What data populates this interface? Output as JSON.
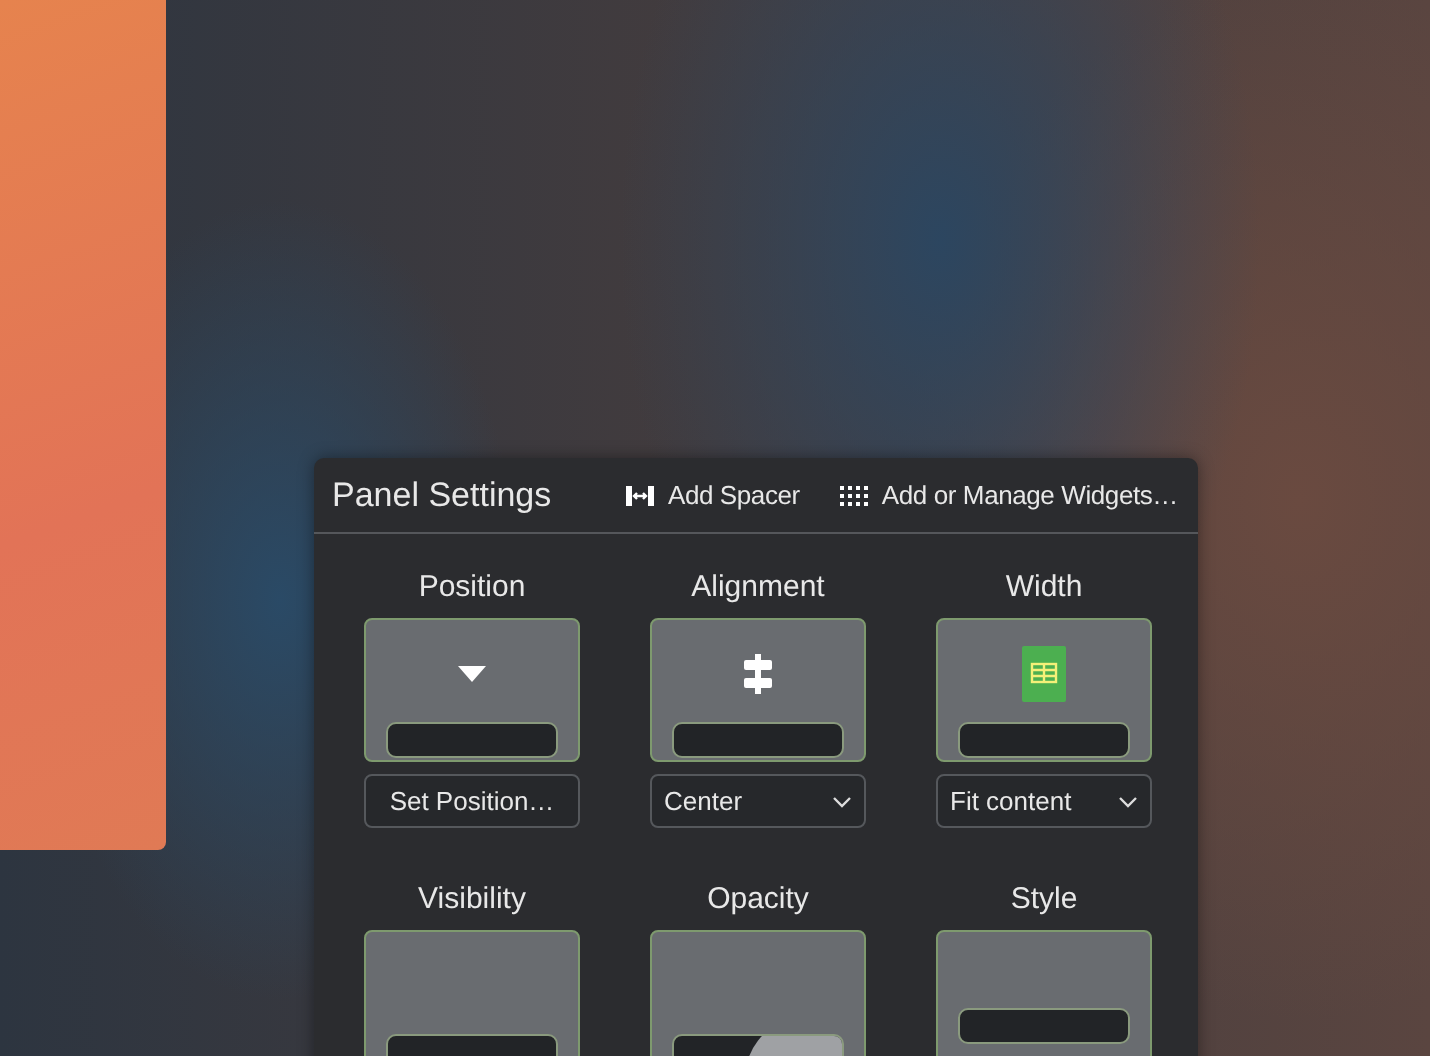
{
  "panel": {
    "title": "Panel Settings",
    "actions": [
      {
        "label": "Add Spacer",
        "kind": "spacer"
      },
      {
        "label": "Add or Manage Widgets…",
        "kind": "widgets"
      }
    ],
    "settings": [
      {
        "label": "Position",
        "kind": "position",
        "control": {
          "kind": "button",
          "text": "Set Position…"
        }
      },
      {
        "label": "Alignment",
        "kind": "alignment",
        "control": {
          "kind": "dropdown",
          "text": "Center"
        }
      },
      {
        "label": "Width",
        "kind": "width",
        "control": {
          "kind": "dropdown",
          "text": "Fit content"
        }
      },
      {
        "label": "Visibility",
        "kind": "visibility"
      },
      {
        "label": "Opacity",
        "kind": "opacity"
      },
      {
        "label": "Style",
        "kind": "style"
      }
    ]
  }
}
